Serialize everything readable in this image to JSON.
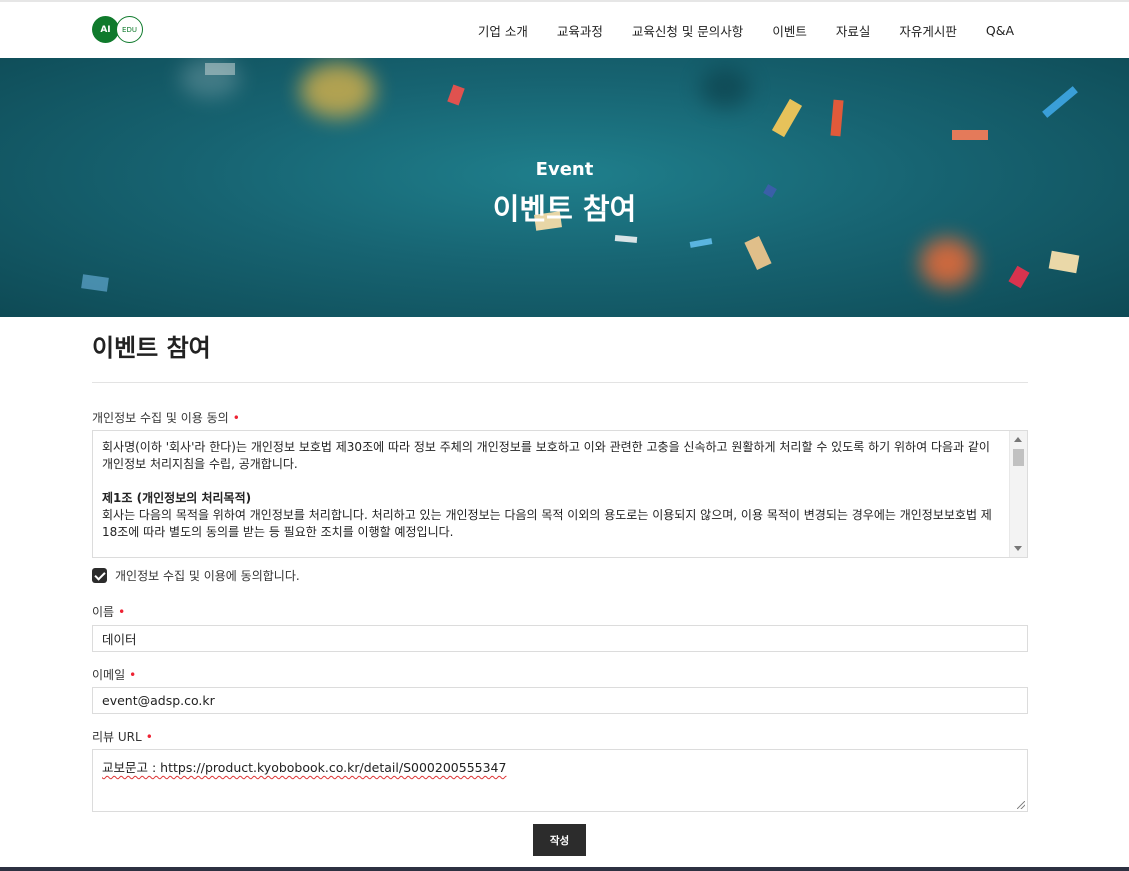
{
  "header": {
    "logo_ai": "AI",
    "logo_edu": "EDU",
    "nav": [
      "기업 소개",
      "교육과정",
      "교육신청 및 문의사항",
      "이벤트",
      "자료실",
      "자유게시판",
      "Q&A"
    ]
  },
  "hero": {
    "subtitle": "Event",
    "title": "이벤트 참여"
  },
  "page_title": "이벤트 참여",
  "form": {
    "privacy": {
      "label": "개인정보 수집 및 이용 동의",
      "required_mark": "•",
      "terms_intro": "회사명(이하 '회사'라 한다)는 개인정보 보호법 제30조에 따라 정보 주체의 개인정보를 보호하고 이와 관련한 고충을 신속하고 원활하게 처리할 수 있도록 하기 위하여 다음과 같이 개인정보 처리지침을 수립, 공개합니다.",
      "article_title": "제1조 (개인정보의 처리목적)",
      "article_body": "회사는 다음의 목적을 위하여 개인정보를 처리합니다. 처리하고 있는 개인정보는 다음의 목적 이외의 용도로는 이용되지 않으며, 이용 목적이 변경되는 경우에는 개인정보보호법 제18조에 따라 별도의 동의를 받는 등 필요한 조치를 이행할 예정입니다.",
      "agree_label": "개인정보 수집 및 이용에 동의합니다.",
      "agreed": true
    },
    "name": {
      "label": "이름",
      "required_mark": "•",
      "value": "데이터"
    },
    "email": {
      "label": "이메일",
      "required_mark": "•",
      "value": "event@adsp.co.kr"
    },
    "review_url": {
      "label": "리뷰 URL",
      "required_mark": "•",
      "value": "교보문고 : https://product.kyobobook.co.kr/detail/S000200555347"
    },
    "submit_label": "작성"
  },
  "colors": {
    "brand_green": "#0f7a2c",
    "hero_teal": "#176472",
    "button_dark": "#2c2c2c",
    "required_red": "#e23333"
  }
}
